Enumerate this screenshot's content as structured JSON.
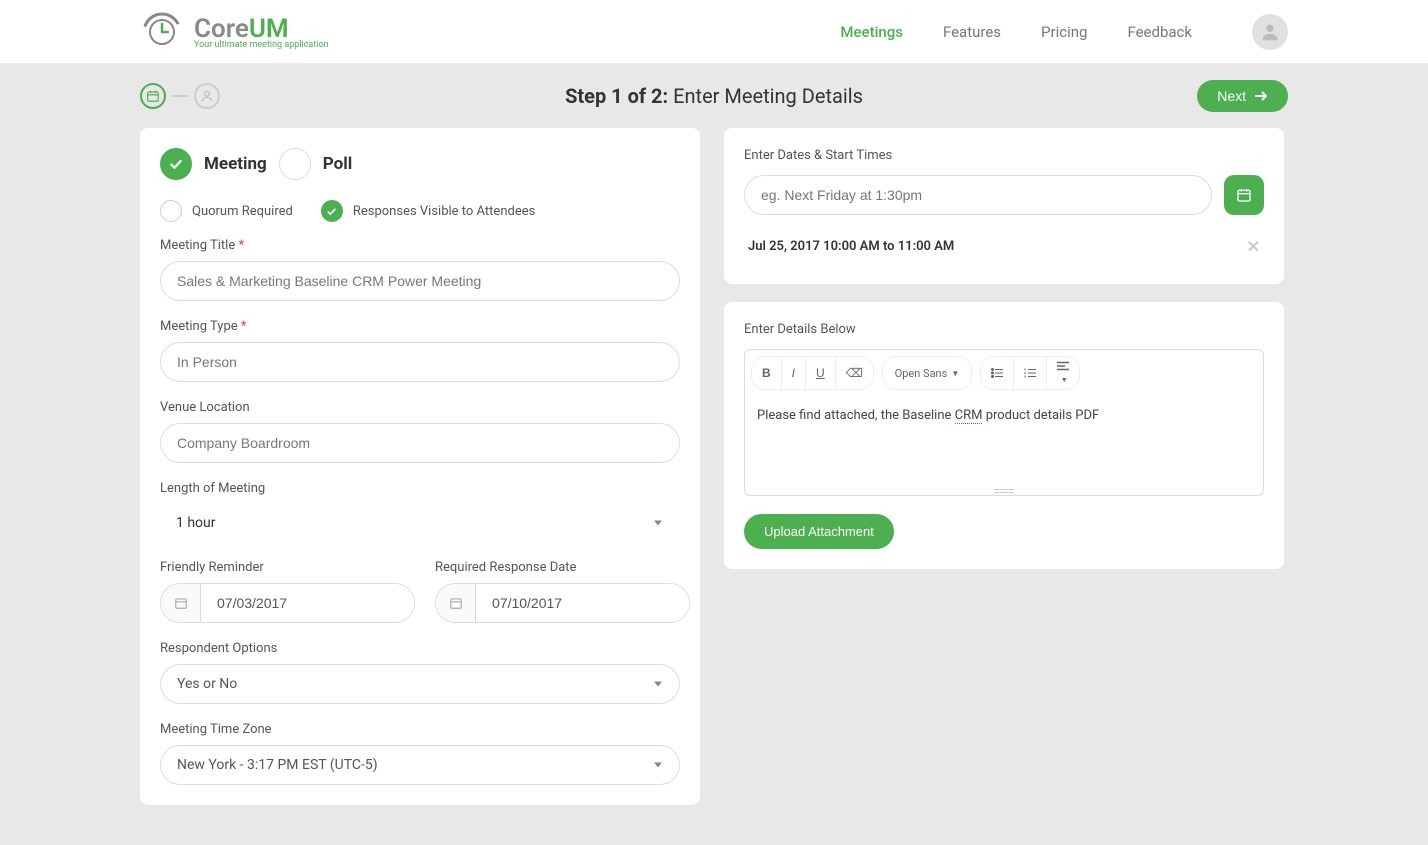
{
  "brand": {
    "name_core": "Core",
    "name_um": "UM",
    "tagline": "Your ultimate meeting application"
  },
  "nav": {
    "meetings": "Meetings",
    "features": "Features",
    "pricing": "Pricing",
    "feedback": "Feedback"
  },
  "step": {
    "label_bold": "Step 1 of 2:",
    "label_rest": " Enter Meeting Details",
    "next_label": "Next"
  },
  "toggle": {
    "meeting": "Meeting",
    "poll": "Poll"
  },
  "checks": {
    "quorum": "Quorum Required",
    "responses_visible": "Responses Visible to Attendees"
  },
  "form": {
    "title_label": "Meeting Title ",
    "title_value": "Sales & Marketing Baseline CRM Power Meeting",
    "type_label": "Meeting Type ",
    "type_value": "In Person",
    "venue_label": "Venue Location",
    "venue_value": "Company Boardroom",
    "length_label": "Length of Meeting",
    "length_value": "1 hour",
    "reminder_label": "Friendly Reminder",
    "reminder_value": "07/03/2017",
    "required_label": "Required Response Date",
    "required_value": "07/10/2017",
    "respondent_label": "Respondent Options",
    "respondent_value": "Yes or No",
    "tz_label": "Meeting Time Zone",
    "tz_value": "New York - 3:17 PM EST (UTC-5)"
  },
  "dates": {
    "section_label": "Enter Dates & Start Times",
    "placeholder": "eg. Next Friday at 1:30pm",
    "slot1": "Jul 25, 2017 10:00 AM to 11:00 AM"
  },
  "details": {
    "section_label": "Enter Details Below",
    "font_label": "Open Sans",
    "body_prefix": "Please find attached, the Baseline ",
    "body_underlined": "CRM",
    "body_suffix": " product details PDF",
    "upload_label": "Upload Attachment"
  }
}
